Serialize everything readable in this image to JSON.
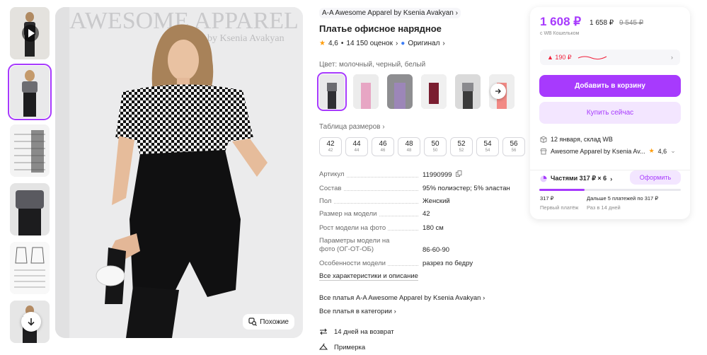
{
  "gallery": {
    "thumbnails": [
      {
        "kind": "video"
      },
      {
        "kind": "photo",
        "active": true
      },
      {
        "kind": "size-chart"
      },
      {
        "kind": "photo"
      },
      {
        "kind": "pattern-sheet"
      },
      {
        "kind": "photo"
      }
    ],
    "main_photo": {
      "watermark_brand": "AWESOME APPAREL",
      "watermark_author": "by Ksenia Avakyan"
    },
    "similar_label": "Похожие"
  },
  "product": {
    "brand": "A-A Awesome Apparel by Ksenia Avakyan",
    "title": "Платье офисное нарядное",
    "rating": "4,6",
    "reviews": "14 150 оценок",
    "original_label": "Оригинал",
    "color_label": "Цвет: молочный, черный, белый",
    "swatches": [
      {
        "color": "#2f2f33",
        "active": true
      },
      {
        "color": "#e7a6c4"
      },
      {
        "color": "#9c86b8"
      },
      {
        "color": "#7a1e30"
      },
      {
        "color": "#3b3b3b"
      },
      {
        "color": "#f28a85"
      }
    ],
    "sizes_label": "Таблица размеров",
    "sizes": [
      {
        "n": "42",
        "s": "42"
      },
      {
        "n": "44",
        "s": "44"
      },
      {
        "n": "46",
        "s": "46"
      },
      {
        "n": "48",
        "s": "48"
      },
      {
        "n": "50",
        "s": "50"
      },
      {
        "n": "52",
        "s": "52"
      },
      {
        "n": "54",
        "s": "54"
      },
      {
        "n": "56",
        "s": "56"
      }
    ],
    "specs": [
      {
        "k": "Артикул",
        "v": "11990999"
      },
      {
        "k": "Состав",
        "v": "95% полиэстер; 5% эластан"
      },
      {
        "k": "Пол",
        "v": "Женский"
      },
      {
        "k": "Размер на модели",
        "v": "42"
      },
      {
        "k": "Рост модели на фото",
        "v": "180 см"
      },
      {
        "k": "Параметры модели на фото (ОГ-ОТ-ОБ)",
        "v": "86-60-90"
      },
      {
        "k": "Особенности модели",
        "v": "разрез по бедру"
      }
    ],
    "all_specs_link": "Все характеристики и описание",
    "all_brand_link": "Все платья A-A Awesome Apparel by Ksenia Avakyan",
    "all_category_link": "Все платья в категории",
    "return_label": "14 дней на возврат",
    "fitting_label": "Примерка"
  },
  "buy_card": {
    "price": "1 608 ₽",
    "price_no_wallet": "1 658 ₽",
    "price_old": "9 545 ₽",
    "wallet_label": "с WB Кошельком",
    "discount": "▲ 190 ₽",
    "add_to_cart": "Добавить в корзину",
    "buy_now": "Купить сейчас",
    "delivery": "12 января, склад WB",
    "seller": "Awesome Apparel by Ksenia Av...",
    "seller_rating": "4,6",
    "installments": "Частями 317 ₽ × 6",
    "order_button": "Оформить",
    "first_payment": "317 ₽",
    "first_payment_sub": "Первый платёж",
    "next_payments": "Дальше 5 платежей по 317 ₽",
    "next_payments_sub": "Раз в 14 дней",
    "paid_fraction": 0.32
  },
  "colors": {
    "accent": "#a73afd",
    "accent_light": "#f3e6ff",
    "discount_red": "#f0203b",
    "star": "#ff9e0d"
  }
}
